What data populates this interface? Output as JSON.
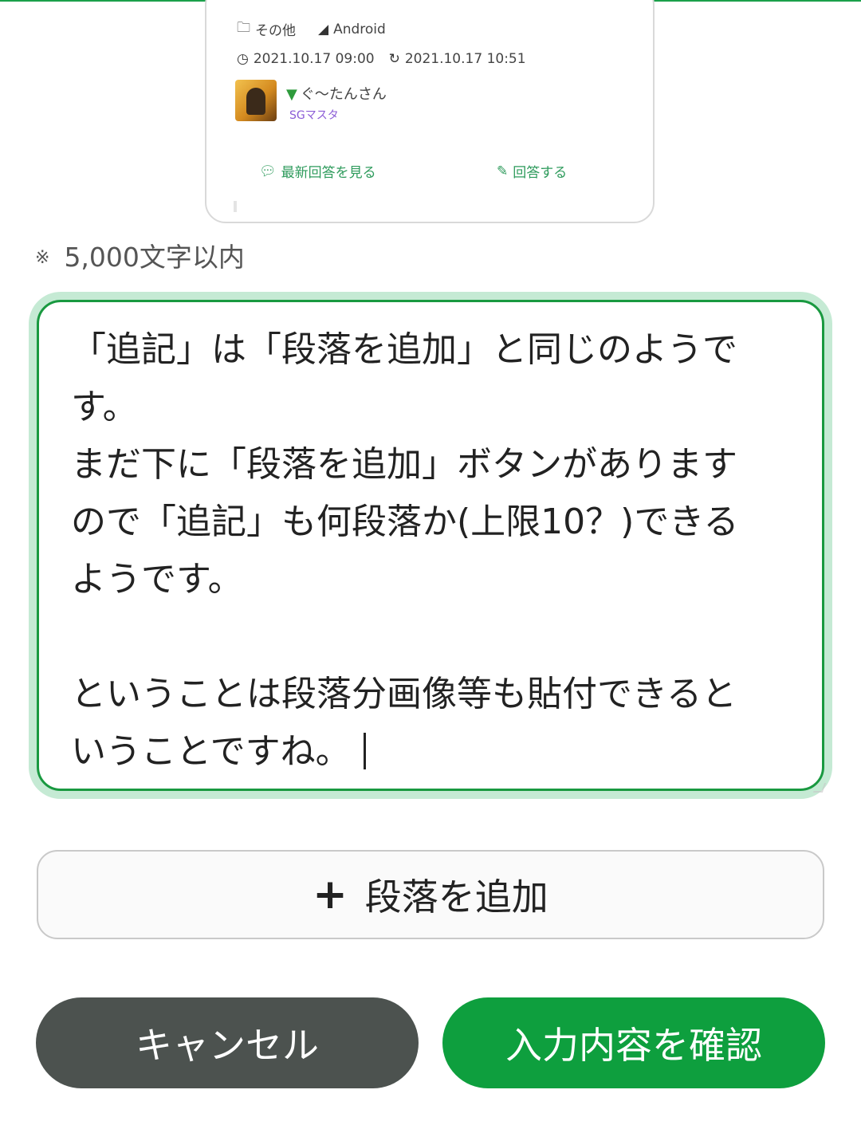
{
  "preview": {
    "category_label": "その他",
    "platform_label": "Android",
    "posted_at": "2021.10.17 09:00",
    "updated_at": "2021.10.17 10:51",
    "user_name": "ぐ〜たんさん",
    "user_rank": "SGマスタ",
    "view_latest_label": "最新回答を見る",
    "answer_label": "回答する",
    "icons": [
      "folder-icon",
      "android-icon",
      "clock-icon",
      "refresh-icon",
      "beginner-leaf-icon",
      "speech-bubble-icon",
      "pencil-icon"
    ]
  },
  "char_limit": {
    "mark": "※",
    "text": "5,000文字以内"
  },
  "editor": {
    "lines": [
      "「追記」は「段落を追加」と同じのようで",
      "す。",
      "まだ下に「段落を追加」ボタンがあります",
      "ので「追記」も何段落か(上限10？)できる",
      "ようです。",
      "",
      "ということは段落分画像等も貼付できると",
      "いうことですね。"
    ]
  },
  "add_paragraph": {
    "icon": "plus-icon",
    "label": "段落を追加"
  },
  "actions": {
    "cancel_label": "キャンセル",
    "confirm_label": "入力内容を確認"
  },
  "colors": {
    "accent_green": "#0e9f3e",
    "focus_ring": "#c5ead4",
    "cancel_gray": "#4c524f",
    "rank_purple": "#8b5cd6"
  }
}
